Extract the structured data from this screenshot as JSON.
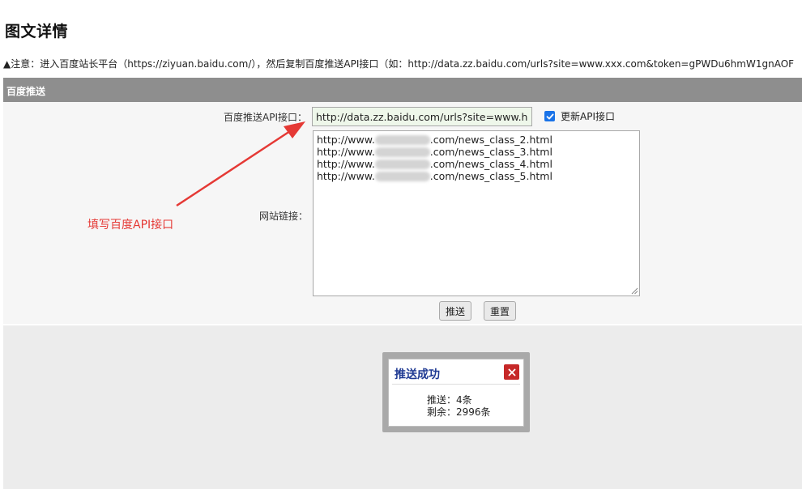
{
  "page": {
    "title": "图文详情",
    "notice": "▲注意：进入百度站长平台（https://ziyuan.baidu.com/），然后复制百度推送API接口（如：http://data.zz.baidu.com/urls?site=www.xxx.com&token=gPWDu6hmW1gnAOF"
  },
  "panel": {
    "header": "百度推送",
    "api_label": "百度推送API接口：",
    "api_value": "http://data.zz.baidu.com/urls?site=www.hn",
    "checkbox_label": "更新API接口",
    "checkbox_checked": true,
    "links_label": "网站链接：",
    "links": [
      {
        "prefix": "http://www.",
        "suffix": ".com/news_class_2.html"
      },
      {
        "prefix": "http://www.",
        "suffix": ".com/news_class_3.html"
      },
      {
        "prefix": "http://www.",
        "suffix": ".com/news_class_4.html"
      },
      {
        "prefix": "http://www.",
        "suffix": ".com/news_class_5.html"
      }
    ],
    "push_button": "推送",
    "reset_button": "重置"
  },
  "dialog": {
    "title": "推送成功",
    "line1": "推送：4条",
    "line2": "剩余：2996条"
  },
  "annotation": {
    "text": "填写百度API接口",
    "color": "#e53935"
  },
  "colors": {
    "header_bg": "#8e8e8e",
    "input_bg": "#eef7ea",
    "checkbox": "#1a73e8",
    "close_button": "#c62828",
    "dialog_title": "#1f3a93"
  }
}
